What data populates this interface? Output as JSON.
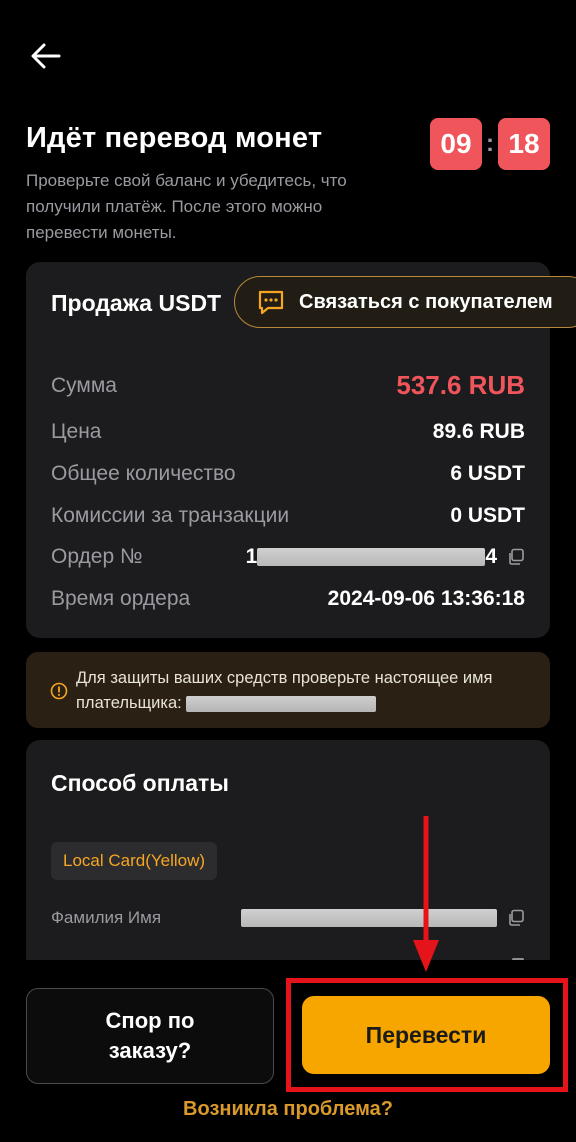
{
  "header": {
    "title": "Идёт перевод монет",
    "subtitle": "Проверьте свой баланс и убедитесь, что получили платёж. После этого можно перевести монеты.",
    "timer": {
      "minutes": "09",
      "separator": ":",
      "seconds": "18"
    }
  },
  "order": {
    "title": "Продажа USDT",
    "contact_label": "Связаться с покупателем",
    "rows": [
      {
        "label": "Сумма",
        "value": "537.6 RUB"
      },
      {
        "label": "Цена",
        "value": "89.6 RUB"
      },
      {
        "label": "Общее количество",
        "value": "6 USDT"
      },
      {
        "label": "Комиссии за транзакции",
        "value": "0 USDT"
      },
      {
        "label": "Ордер №",
        "value_prefix": "1",
        "value_suffix": "4"
      },
      {
        "label": "Время ордера",
        "value": "2024-09-06 13:36:18"
      }
    ]
  },
  "warning": {
    "text": "Для защиты ваших средств проверьте настоящее имя плательщика:"
  },
  "payment": {
    "title": "Способ оплаты",
    "method": "Local Card(Yellow)",
    "name_label": "Фамилия Имя"
  },
  "actions": {
    "dispute_line1": "Спор по",
    "dispute_line2": "заказу?",
    "transfer_label": "Перевести",
    "problem_label": "Возникла проблема?"
  },
  "colors": {
    "accent_red": "#f0555b",
    "brand_yellow": "#f7a600",
    "highlight_red": "#e5141b"
  }
}
